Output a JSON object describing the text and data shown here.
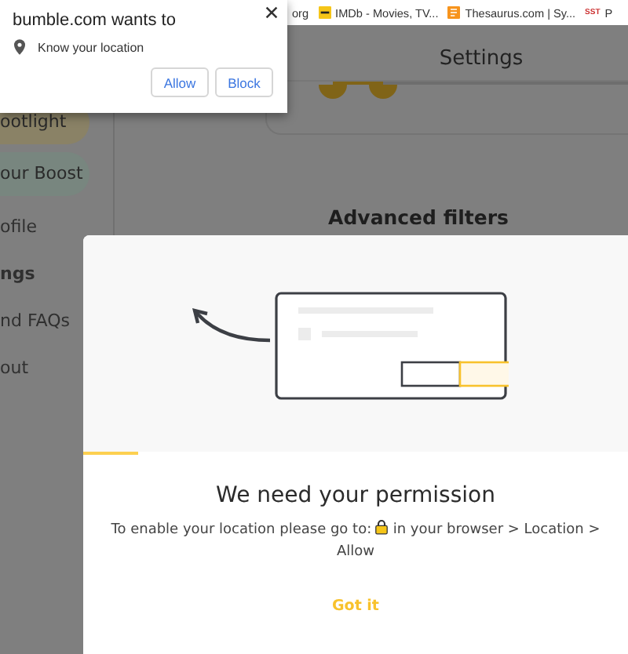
{
  "bookmarks": [
    {
      "label": "org",
      "kind": "none"
    },
    {
      "label": "IMDb - Movies, TV...",
      "kind": "imdb"
    },
    {
      "label": "Thesaurus.com | Sy...",
      "kind": "thesaurus"
    },
    {
      "label": "P",
      "kind": "sst",
      "icon_text": "SST"
    }
  ],
  "browser_prompt": {
    "title": "bumble.com wants to",
    "permission": "Know your location",
    "buttons": [
      "Allow",
      "Block"
    ]
  },
  "sidebar": {
    "items": [
      {
        "label": "ootlight",
        "kind": "pill",
        "color": "#8a8266"
      },
      {
        "label": "our Boost",
        "kind": "pill",
        "color": "#78867f"
      },
      {
        "label": "ofile",
        "kind": "link",
        "selected": false
      },
      {
        "label": "ngs",
        "kind": "link",
        "selected": true
      },
      {
        "label": "nd FAQs",
        "kind": "link",
        "selected": false
      },
      {
        "label": "out",
        "kind": "link",
        "selected": false
      }
    ]
  },
  "header": {
    "title": "Settings"
  },
  "slider": {
    "level": 0.17
  },
  "section": {
    "title": "Advanced filters"
  },
  "modal": {
    "title": "We need your permission",
    "text_before": "To enable your location please go to:",
    "text_after": "in your browser > Location > Allow",
    "button": "Got it"
  }
}
